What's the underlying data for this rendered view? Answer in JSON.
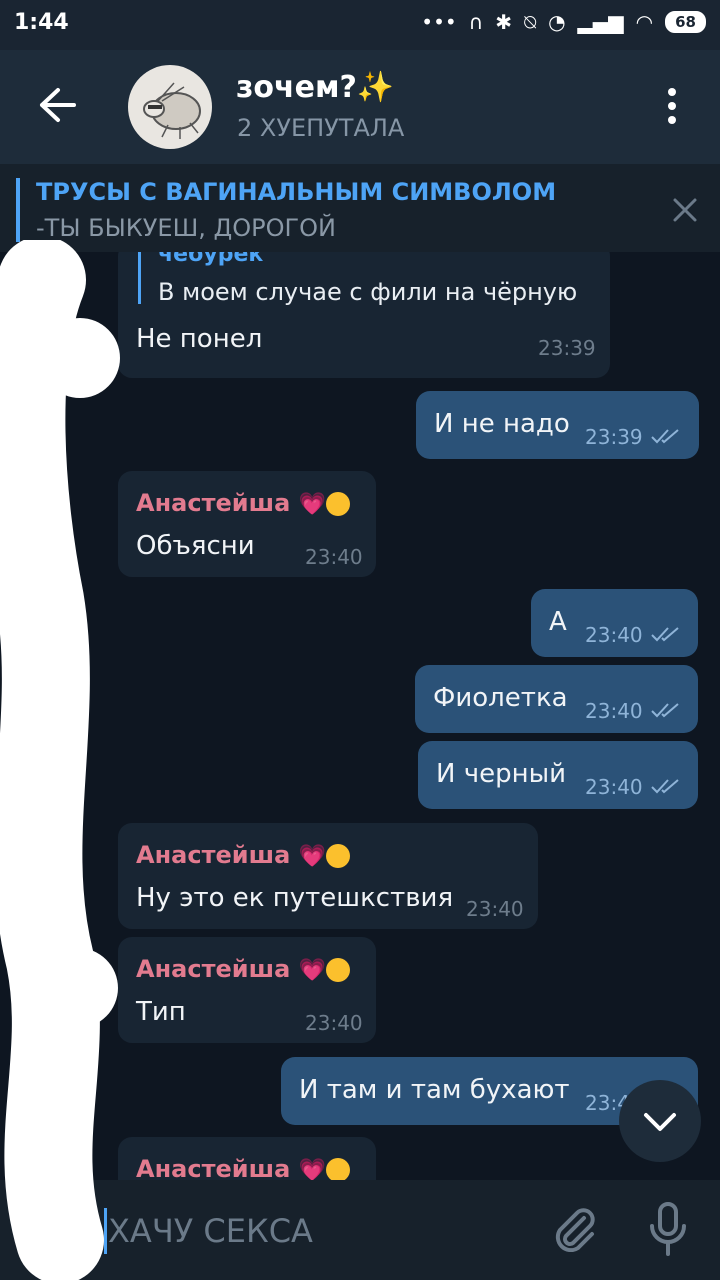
{
  "status": {
    "time": "1:44",
    "battery": "68"
  },
  "header": {
    "title": "зочем?✨",
    "subtitle": "2 ХУЕПУТАЛА"
  },
  "pinned": {
    "title": "ТРУСЫ С ВАГИНАЛЬНЫМ СИМВОЛОМ",
    "text": "-ТЫ БЫКУЕШ, ДОРОГОЙ"
  },
  "messages": [
    {
      "reply_name": "чебурек",
      "reply_text": "В моем случае с фили на чёрную",
      "text": "Не понел",
      "time": "23:39"
    },
    {
      "text": "И не надо",
      "time": "23:39"
    },
    {
      "sender": "Анастейша",
      "text": "Объясни",
      "time": "23:40"
    },
    {
      "text": "А",
      "time": "23:40"
    },
    {
      "text": "Фиолетка",
      "time": "23:40"
    },
    {
      "text": "И черный",
      "time": "23:40"
    },
    {
      "sender": "Анастейша",
      "text": "Ну это ек путешкствия",
      "time": "23:40"
    },
    {
      "sender": "Анастейша",
      "text": "Тип",
      "time": "23:40"
    },
    {
      "text": "И там и там бухают",
      "time": "23:4"
    },
    {
      "sender": "Анастейша"
    }
  ],
  "input": {
    "value": "ХАЧУ СЕКСА"
  },
  "colors": {
    "background": "#0e1621",
    "incoming": "#182533",
    "outgoing": "#2b5278",
    "accent": "#4ea4f6",
    "sender": "#e27b8f"
  }
}
